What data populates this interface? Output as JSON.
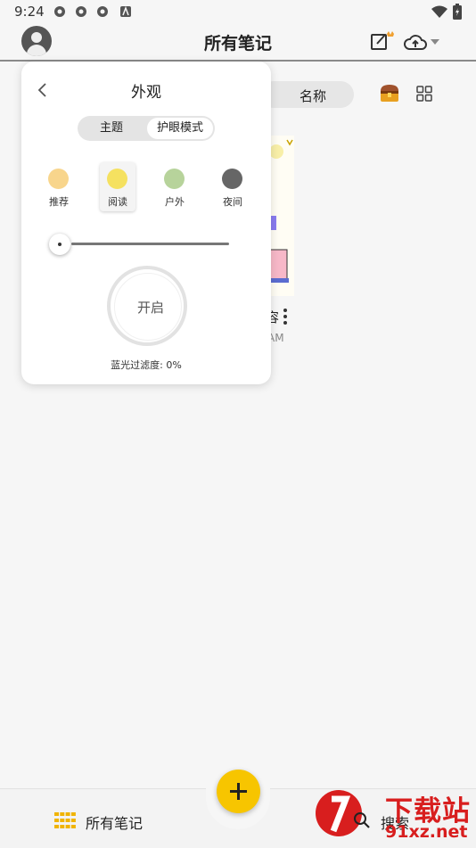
{
  "status_bar": {
    "time": "9:24"
  },
  "app_bar": {
    "title": "所有笔记"
  },
  "content": {
    "sort_label": "名称",
    "card_title_fragment": "容",
    "card_time_fragment": "AM"
  },
  "appearance_panel": {
    "title": "外观",
    "tabs": [
      {
        "label": "主题",
        "selected": false
      },
      {
        "label": "护眼模式",
        "selected": true
      }
    ],
    "modes": [
      {
        "label": "推荐",
        "color": "#f8d58c",
        "selected": false
      },
      {
        "label": "阅读",
        "color": "#f5e160",
        "selected": true
      },
      {
        "label": "户外",
        "color": "#b7d39b",
        "selected": false
      },
      {
        "label": "夜间",
        "color": "#666666",
        "selected": false
      }
    ],
    "slider_value": 0,
    "toggle_label": "开启",
    "blue_light_label": "蓝光过滤度: 0%"
  },
  "bottom_nav": {
    "all_notes_label": "所有笔记",
    "search_label": "搜索"
  },
  "watermark": {
    "word": "下载站",
    "url": "91xz.net"
  },
  "colors": {
    "accent": "#f7c500",
    "watermark": "#d81e1e"
  }
}
